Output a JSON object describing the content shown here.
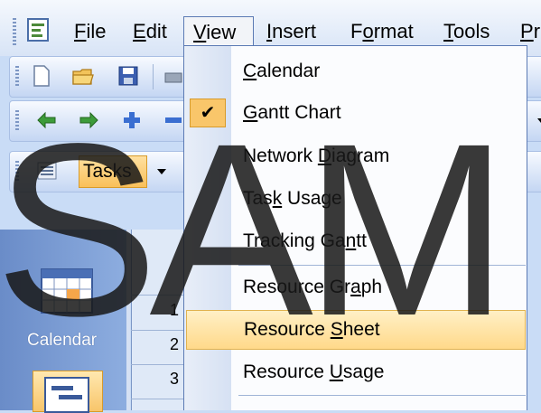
{
  "menubar": {
    "items": [
      {
        "label_pre": "",
        "accel": "F",
        "label_post": "ile"
      },
      {
        "label_pre": "",
        "accel": "E",
        "label_post": "dit"
      },
      {
        "label_pre": "",
        "accel": "V",
        "label_post": "iew"
      },
      {
        "label_pre": "",
        "accel": "I",
        "label_post": "nsert"
      },
      {
        "label_pre": "F",
        "accel": "o",
        "label_post": "rmat"
      },
      {
        "label_pre": "",
        "accel": "T",
        "label_post": "ools"
      },
      {
        "label_pre": "",
        "accel": "P",
        "label_post": "r"
      }
    ]
  },
  "viewbar": {
    "tasks_label": "Tasks",
    "calendar_label": "Calendar"
  },
  "grid": {
    "row_numbers": [
      "1",
      "2",
      "3"
    ]
  },
  "view_menu": {
    "items": [
      {
        "pre": "",
        "accel": "C",
        "post": "alendar",
        "checked": false
      },
      {
        "pre": "",
        "accel": "G",
        "post": "antt Chart",
        "checked": true
      },
      {
        "pre": "Network ",
        "accel": "D",
        "post": "iagram",
        "checked": false
      },
      {
        "pre": "Tas",
        "accel": "k",
        "post": " Usage",
        "checked": false
      },
      {
        "pre": "Tracking Ga",
        "accel": "n",
        "post": "tt",
        "checked": false
      },
      {
        "pre": "Resource Gr",
        "accel": "a",
        "post": "ph",
        "checked": false
      },
      {
        "pre": "Resource ",
        "accel": "S",
        "post": "heet",
        "checked": false
      },
      {
        "pre": "Resource ",
        "accel": "U",
        "post": "sage",
        "checked": false
      }
    ],
    "highlighted_item": "Resource Sheet"
  },
  "watermark": "SAM",
  "colors": {
    "menu_border": "#5b7ab4",
    "highlight": "#ffd98a",
    "check_bg": "#f9c66a",
    "viewbar": "#6a8cc8"
  }
}
